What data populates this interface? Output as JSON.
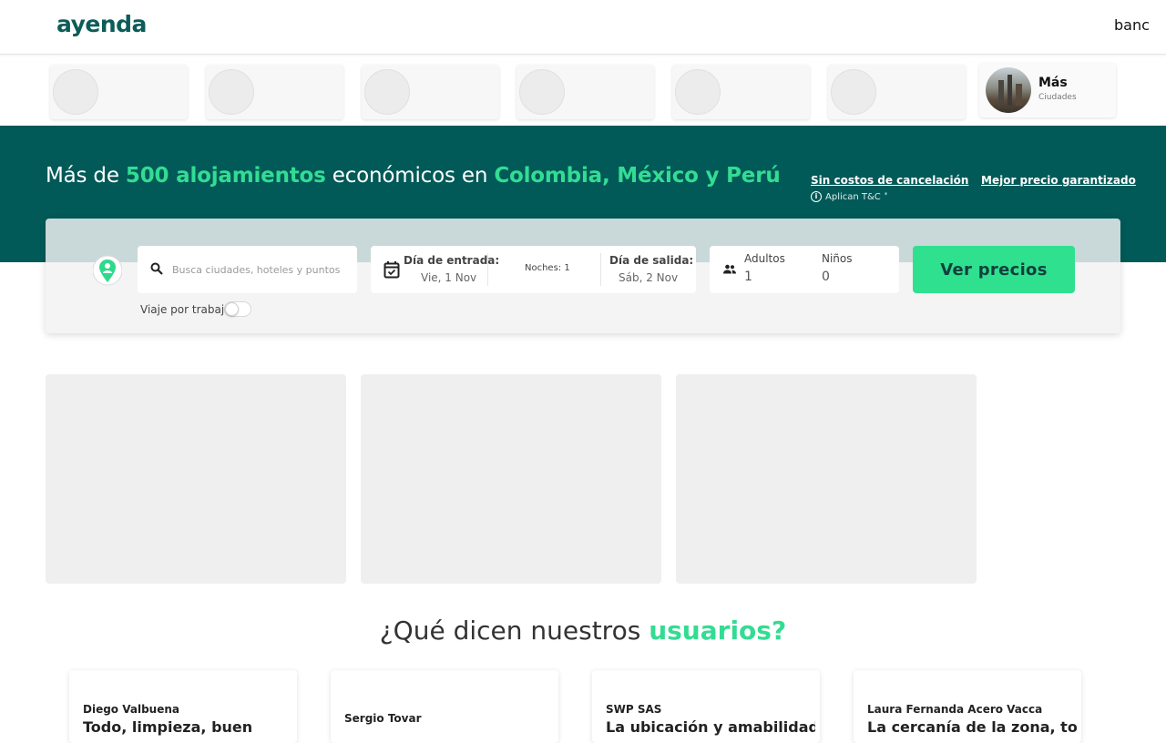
{
  "header": {
    "logo": "ayenda",
    "right_link": "banc"
  },
  "cities": {
    "more": {
      "title": "Más",
      "subtitle": "Ciudades"
    }
  },
  "hero": {
    "title_pre": "Más de ",
    "title_accent1": "500 alojamientos",
    "title_mid": " económicos en ",
    "title_accent2": "Colombia, México y Perú",
    "link_cancel": "Sin costos de cancelación",
    "link_price": "Mejor precio garantizado",
    "terms": "Aplican T&C",
    "terms_mark": "*"
  },
  "search": {
    "placeholder": "Busca ciudades, hoteles y puntos",
    "checkin_label": "Día de entrada:",
    "checkin_value": "Vie, 1 Nov",
    "nights": "Noches: 1",
    "checkout_label": "Día de salida:",
    "checkout_value": "Sáb, 2 Nov",
    "adults_label": "Adultos",
    "adults_value": "1",
    "kids_label": "Niños",
    "kids_value": "0",
    "submit": "Ver precios",
    "work_trip": "Viaje por trabajo"
  },
  "testimonials": {
    "title_pre": "¿Qué dicen nuestros ",
    "title_accent": "usuarios?",
    "items": [
      {
        "name": "Diego Valbuena",
        "text": "Todo, limpieza, buen"
      },
      {
        "name": "Sergio Tovar",
        "text": ""
      },
      {
        "name": "SWP SAS",
        "text": "La ubicación y amabilidad de"
      },
      {
        "name": "Laura Fernanda Acero Vacca",
        "text": "La cercanía de la zona, todo"
      }
    ]
  },
  "colors": {
    "brand": "#0d5c58",
    "hero_bg": "#015a58",
    "accent": "#33dc93",
    "button": "#2fe08f"
  },
  "icons": [
    "search-icon",
    "calendar-check-icon",
    "people-icon",
    "location-pin-icon",
    "info-icon"
  ]
}
